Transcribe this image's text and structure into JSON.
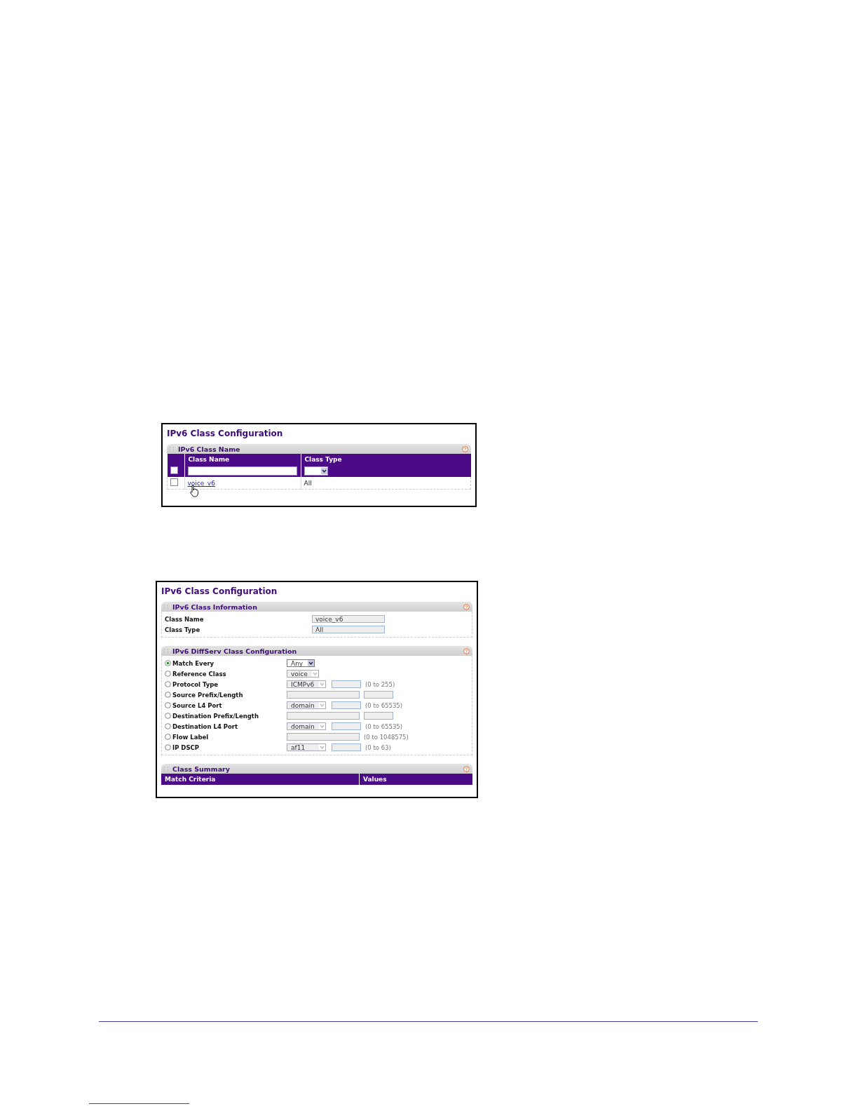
{
  "class_list": {
    "title": "IPv6 Class Configuration",
    "panel": "IPv6 Class Name",
    "columns": [
      "Class Name",
      "Class Type"
    ],
    "new_row": {
      "checked": false
    },
    "rows": [
      {
        "name": "voice_v6",
        "type": "All",
        "checked": false
      }
    ]
  },
  "class_detail": {
    "title": "IPv6 Class Configuration",
    "info": {
      "panel": "IPv6 Class Information",
      "fields": [
        {
          "label": "Class Name",
          "value": "voice_v6"
        },
        {
          "label": "Class Type",
          "value": "All"
        }
      ]
    },
    "diffserv": {
      "panel": "IPv6 DiffServ Class Configuration",
      "options": [
        {
          "kind": "select",
          "label": "Match Every",
          "selected": true,
          "select": "Any",
          "disabled": false
        },
        {
          "kind": "select",
          "label": "Reference Class",
          "selected": false,
          "select": "voice",
          "disabled": true
        },
        {
          "kind": "select_range",
          "label": "Protocol Type",
          "selected": false,
          "select": "ICMPv6",
          "disabled": true,
          "range": "(0 to 255)"
        },
        {
          "kind": "prefix",
          "label": "Source Prefix/Length",
          "selected": false
        },
        {
          "kind": "select_range",
          "label": "Source L4 Port",
          "selected": false,
          "select": "domain",
          "disabled": true,
          "range": "(0 to 65535)"
        },
        {
          "kind": "prefix",
          "label": "Destination Prefix/Length",
          "selected": false
        },
        {
          "kind": "select_range",
          "label": "Destination L4 Port",
          "selected": false,
          "select": "domain",
          "disabled": true,
          "range": "(0 to 65535)"
        },
        {
          "kind": "field_range",
          "label": "Flow Label",
          "selected": false,
          "range": "(0 to 1048575)"
        },
        {
          "kind": "select_range",
          "label": "IP DSCP",
          "selected": false,
          "select": "af11",
          "disabled": true,
          "range": "(0 to 63)"
        }
      ]
    },
    "summary": {
      "panel": "Class Summary",
      "columns": [
        "Match Criteria",
        "Values"
      ]
    }
  }
}
